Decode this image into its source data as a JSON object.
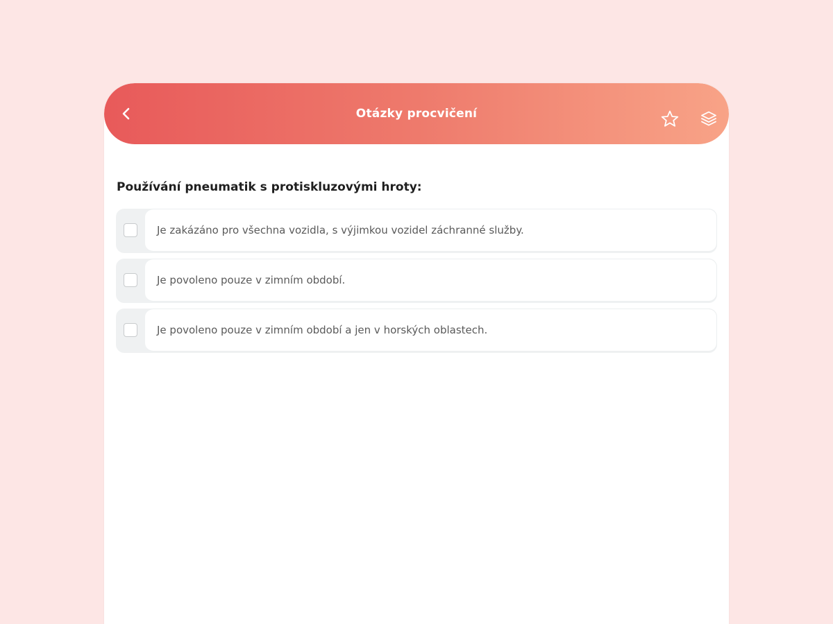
{
  "header": {
    "title": "Otázky procvičení",
    "back_icon": "chevron-left-icon",
    "favorite_icon": "star-outline-icon",
    "layers_icon": "layers-icon",
    "gradient_start": "#e85a5a",
    "gradient_end": "#f8a387"
  },
  "question": {
    "text": "Používání pneumatik s protiskluzovými hroty:"
  },
  "answers": [
    {
      "text": "Je zakázáno pro všechna vozidla, s výjimkou vozidel záchranné služby.",
      "checked": false
    },
    {
      "text": "Je povoleno pouze v zimním období.",
      "checked": false
    },
    {
      "text": "Je povoleno pouze v zimním období a jen v horských oblastech.",
      "checked": false
    }
  ],
  "colors": {
    "page_background": "#fde6e5",
    "card_background": "#ffffff",
    "answer_strip": "#eff1f2"
  }
}
